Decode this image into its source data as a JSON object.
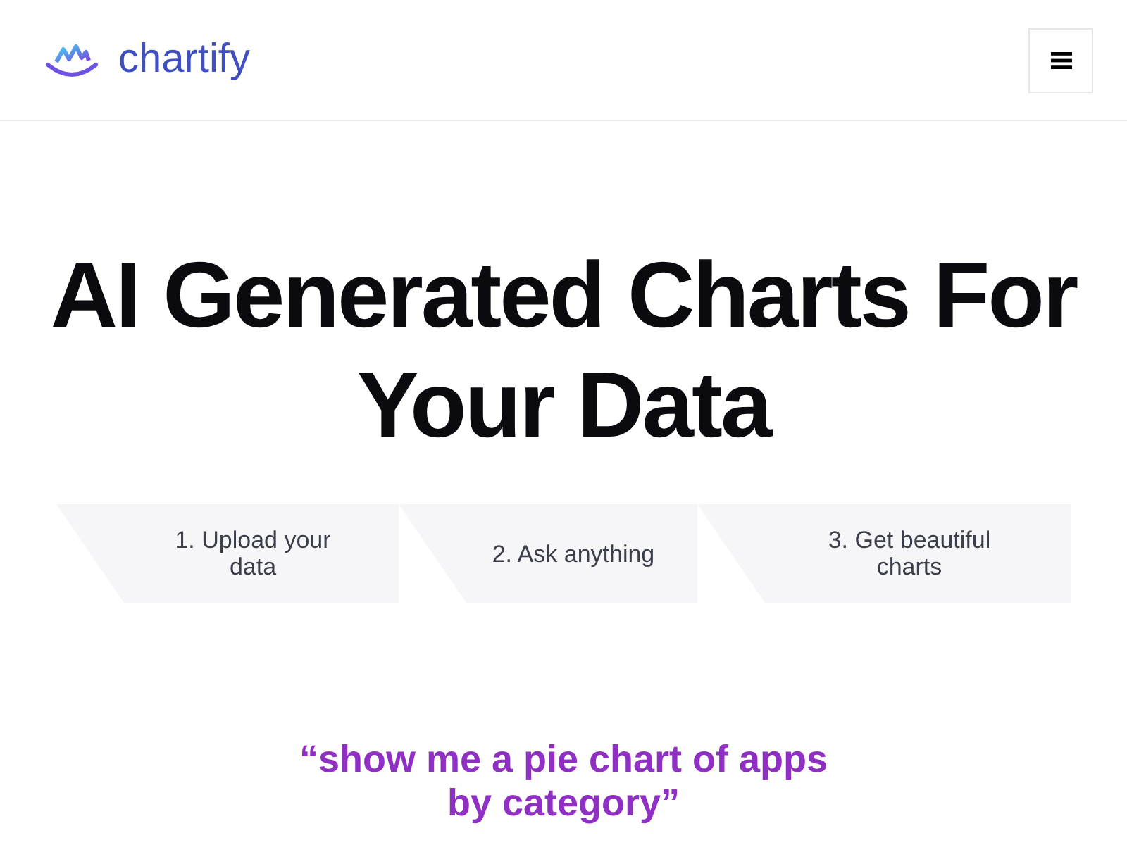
{
  "header": {
    "brand": "chartify"
  },
  "hero": {
    "title": "AI Generated Charts For Your Data"
  },
  "steps": [
    {
      "label": "1. Upload your data"
    },
    {
      "label": "2. Ask anything"
    },
    {
      "label": "3. Get beautiful charts"
    }
  ],
  "prompt": {
    "quote": "“show me a pie chart of apps by category”"
  }
}
